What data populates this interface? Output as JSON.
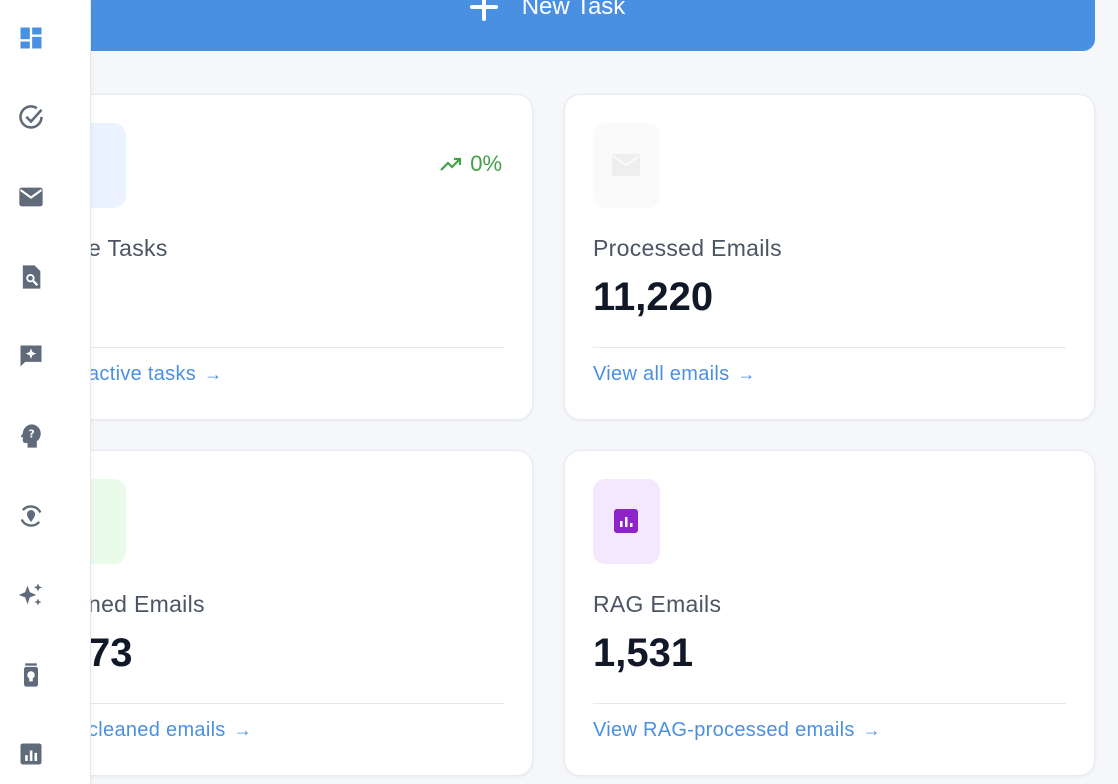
{
  "toolbar": {
    "new_task_label": "New Task"
  },
  "cards": [
    {
      "label": "e Tasks",
      "value": "",
      "link": "active tasks",
      "trend": "0%"
    },
    {
      "label": "Processed Emails",
      "value": "11,220",
      "link": "View all emails"
    },
    {
      "label": "ned Emails",
      "value": "73",
      "link": "cleaned emails"
    },
    {
      "label": "RAG Emails",
      "value": "1,531",
      "link": "View RAG-processed emails"
    }
  ],
  "colors": {
    "accent": "#4a90e2",
    "trend_positive": "#43a047",
    "rag_icon_bg": "#f3e8fd",
    "rag_icon": "#8e24c8"
  },
  "sidebar": {
    "items": [
      {
        "icon": "dashboard-icon"
      },
      {
        "icon": "check-circle-icon"
      },
      {
        "icon": "mail-icon"
      },
      {
        "icon": "search-document-icon"
      },
      {
        "icon": "sparkle-chat-icon"
      },
      {
        "icon": "head-question-icon"
      },
      {
        "icon": "sync-location-icon"
      },
      {
        "icon": "sparkles-icon"
      },
      {
        "icon": "lightbulb-jar-icon"
      },
      {
        "icon": "bar-chart-icon"
      }
    ]
  }
}
